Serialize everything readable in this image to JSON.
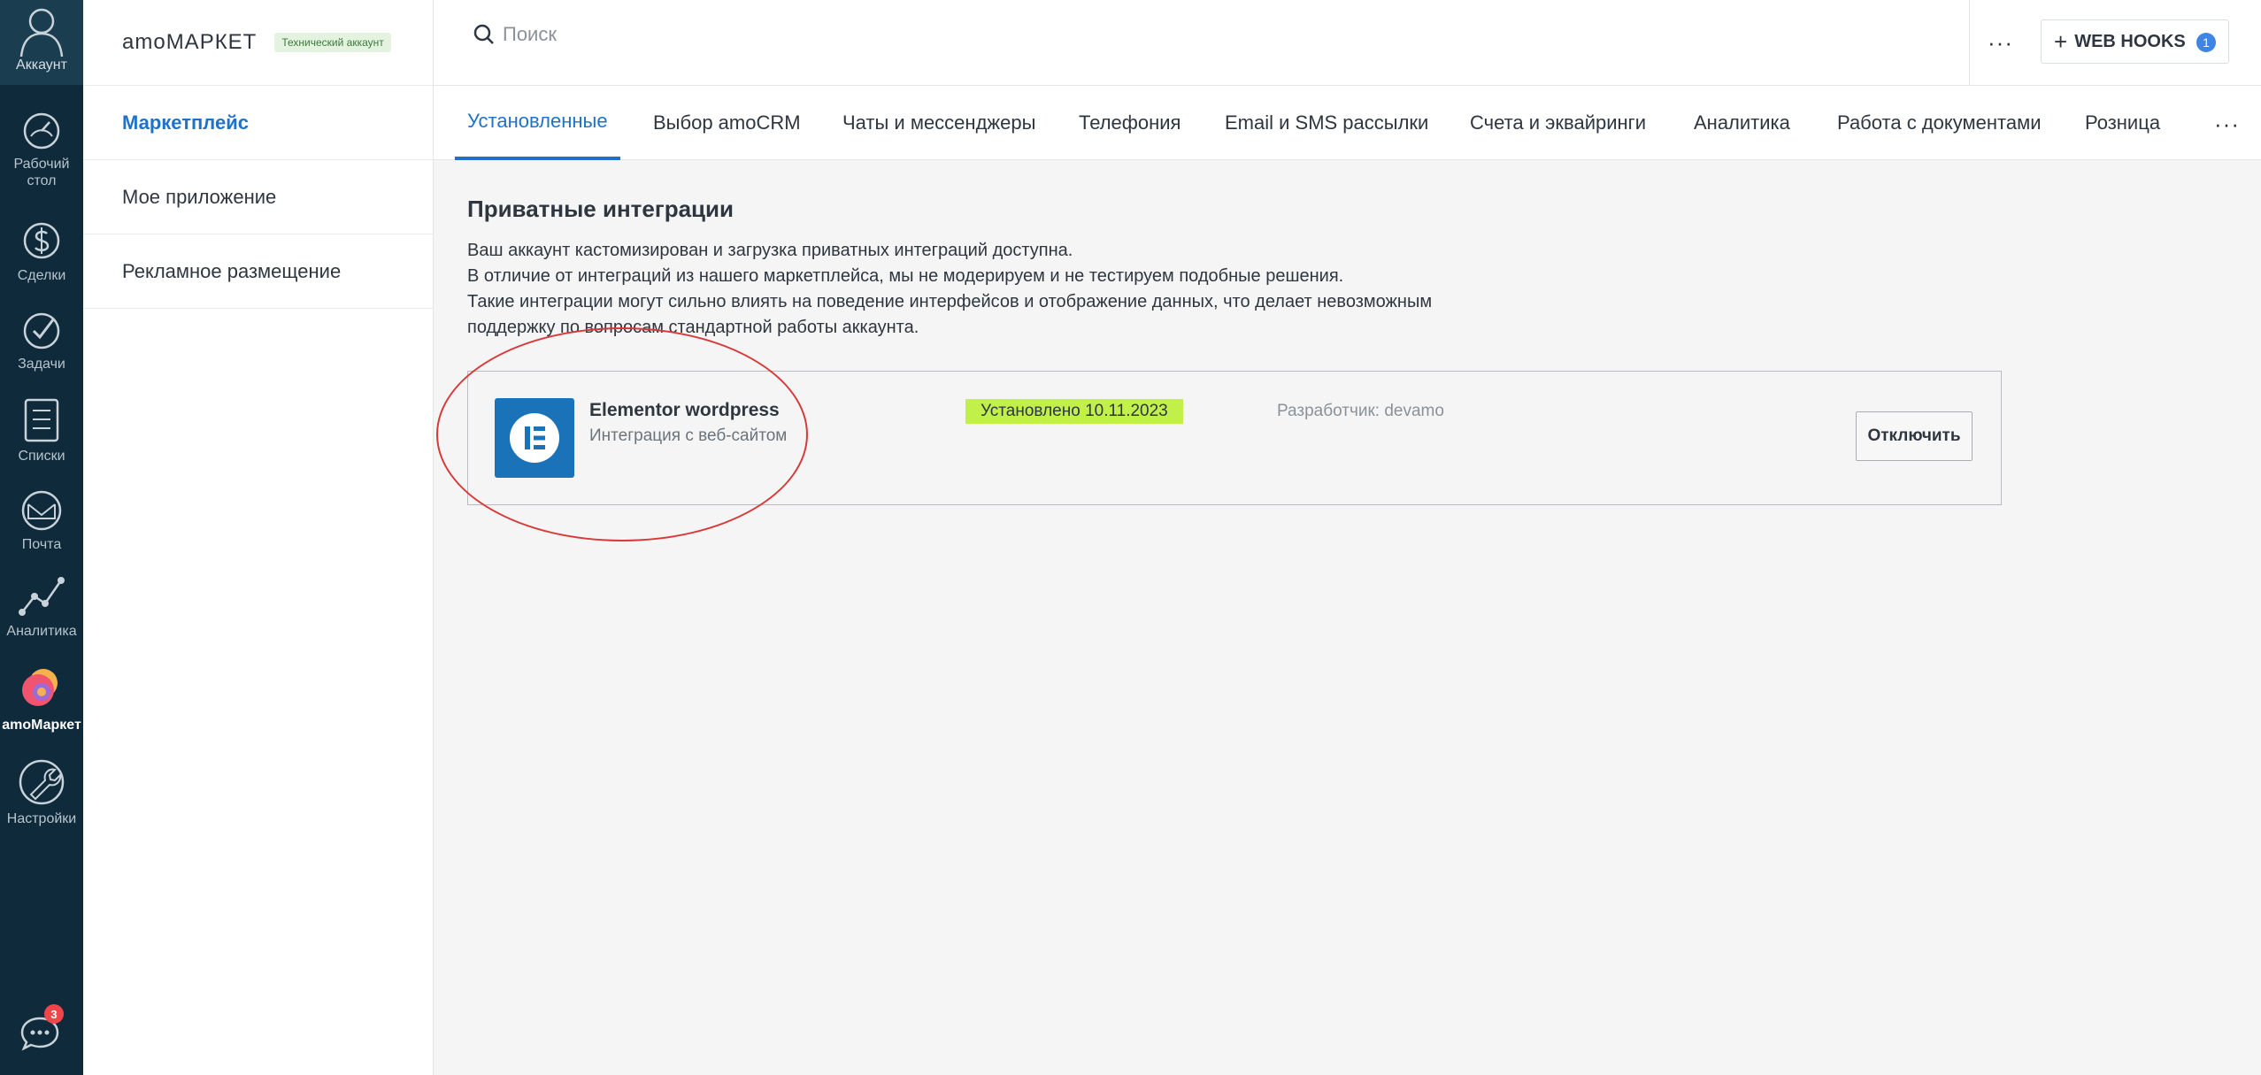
{
  "rail": {
    "account_label": "Аккаунт",
    "items": [
      {
        "icon": "dashboard-icon",
        "label_line1": "Рабочий",
        "label_line2": "стол"
      },
      {
        "icon": "deals-dollar-icon",
        "label": "Сделки"
      },
      {
        "icon": "tasks-check-icon",
        "label": "Задачи"
      },
      {
        "icon": "lists-icon",
        "label": "Списки"
      },
      {
        "icon": "mail-icon",
        "label": "Почта"
      },
      {
        "icon": "analytics-icon",
        "label": "Аналитика"
      },
      {
        "icon": "amomarket-icon",
        "label": "amoМаркет",
        "active": true
      },
      {
        "icon": "settings-wrench-icon",
        "label": "Настройки"
      }
    ],
    "chat_badge": "3"
  },
  "sidebar": {
    "brand": "amoМАРКЕТ",
    "badge": "Технический аккаунт",
    "items": [
      {
        "label": "Маркетплейс",
        "active": true
      },
      {
        "label": "Мое приложение"
      },
      {
        "label": "Рекламное размещение"
      }
    ]
  },
  "topbar": {
    "search_placeholder": "Поиск",
    "more": "···",
    "webhooks_label": "WEB HOOKS",
    "webhooks_count": "1"
  },
  "tabs": [
    {
      "label": "Установленные",
      "active": true
    },
    {
      "label": "Выбор amoCRM"
    },
    {
      "label": "Чаты и мессенджеры"
    },
    {
      "label": "Телефония"
    },
    {
      "label": "Email и SMS рассылки"
    },
    {
      "label": "Счета и эквайринги"
    },
    {
      "label": "Аналитика"
    },
    {
      "label": "Работа с документами"
    },
    {
      "label": "Розница"
    }
  ],
  "tabs_more": "···",
  "content": {
    "title": "Приватные интеграции",
    "notice": [
      "Ваш аккаунт кастомизирован и загрузка приватных интеграций доступна.",
      "В отличие от интеграций из нашего маркетплейса, мы не модерируем и не тестируем подобные решения.",
      "Такие интеграции могут сильно влиять на поведение интерфейсов и отображение данных, что делает невозможным",
      "поддержку по вопросам стандартной работы аккаунта."
    ],
    "integration": {
      "name": "Elementor wordpress",
      "description": "Интеграция с веб-сайтом",
      "installed": "Установлено 10.11.2023",
      "developer": "Разработчик: devamo",
      "disable_label": "Отключить",
      "logo_icon": "elementor-logo-icon",
      "logo_color": "#1a73b8"
    },
    "annotation_color": "#d83a3a"
  },
  "colors": {
    "rail_bg": "#0e2a3b",
    "accent": "#1f72c8",
    "installed_bg": "#c2f04a",
    "badge_red": "#f2444b"
  }
}
